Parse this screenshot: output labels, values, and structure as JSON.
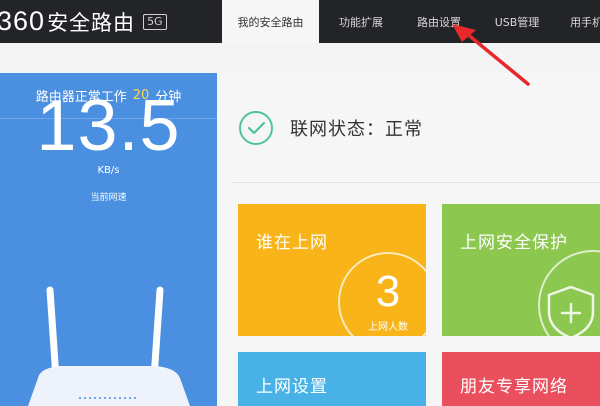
{
  "header": {
    "logo_number": "360",
    "logo_text": "安全路由",
    "logo_badge": "5G",
    "nav": [
      {
        "label": "我的安全路由",
        "active": true
      },
      {
        "label": "功能扩展",
        "active": false
      },
      {
        "label": "路由设置",
        "active": false
      },
      {
        "label": "USB管理",
        "active": false
      },
      {
        "label": "用手机",
        "active": false
      }
    ]
  },
  "sidebar": {
    "status_prefix": "路由器正常工作",
    "minutes": "20",
    "status_suffix": "分钟",
    "speed": "13.5",
    "unit": "KB/s",
    "speed_label": "当前网速"
  },
  "main": {
    "status_text": "联网状态：正常",
    "tiles": {
      "who": {
        "title": "谁在上网",
        "count": "3",
        "count_label": "上网人数"
      },
      "safe": {
        "title": "上网安全保护"
      },
      "net": {
        "title": "上网设置"
      },
      "friend": {
        "title": "朋友专享网络"
      }
    }
  },
  "colors": {
    "topbar": "#222427",
    "blue_panel": "#4a8fe0",
    "tile_yellow": "#f8b418",
    "tile_green": "#8cc74f",
    "tile_blue": "#48b2e7",
    "tile_red": "#ea4f5e",
    "status_check": "#4fc3a1",
    "annotation_arrow": "#e8282b"
  }
}
